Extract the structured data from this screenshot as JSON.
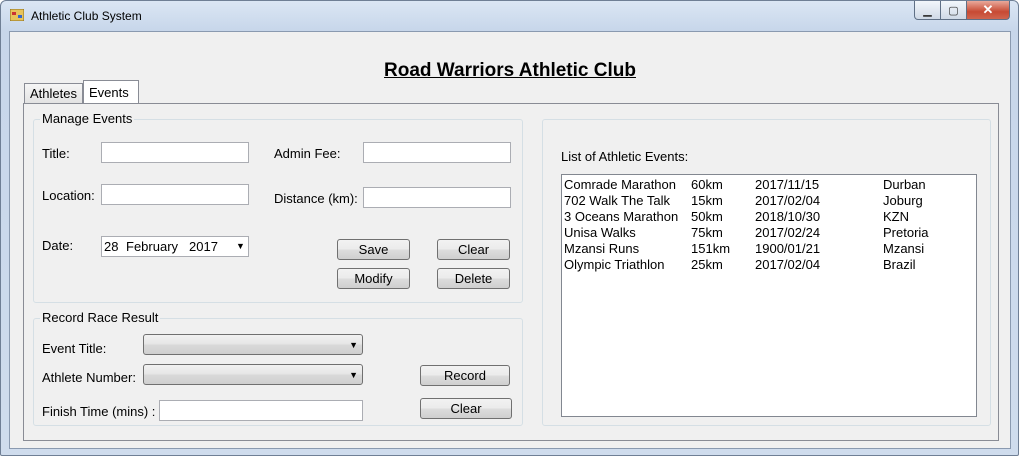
{
  "window": {
    "title": "Athletic Club System"
  },
  "header": {
    "club_title": "Road Warriors Athletic Club"
  },
  "tabs": [
    {
      "label": "Athletes"
    },
    {
      "label": "Events"
    }
  ],
  "manage_events": {
    "legend": "Manage Events",
    "title_label": "Title:",
    "location_label": "Location:",
    "date_label": "Date:",
    "admin_fee_label": "Admin Fee:",
    "distance_label": "Distance (km):",
    "title_value": "",
    "location_value": "",
    "admin_fee_value": "",
    "distance_value": "",
    "date": {
      "day": "28",
      "month": "February",
      "year": "2017"
    },
    "save_label": "Save",
    "clear_label": "Clear",
    "modify_label": "Modify",
    "delete_label": "Delete"
  },
  "race_result": {
    "legend": "Record Race Result",
    "event_title_label": "Event Title:",
    "athlete_number_label": "Athlete Number:",
    "finish_time_label": "Finish Time (mins) :",
    "event_title_value": "",
    "athlete_number_value": "",
    "finish_time_value": "",
    "record_label": "Record",
    "clear_label": "Clear"
  },
  "events_list": {
    "label": "List of Athletic Events:",
    "items": [
      {
        "title": "Comrade Marathon",
        "distance": "60km",
        "date": "2017/11/15",
        "location": "Durban"
      },
      {
        "title": "702 Walk The Talk",
        "distance": "15km",
        "date": "2017/02/04",
        "location": "Joburg"
      },
      {
        "title": "3 Oceans Marathon",
        "distance": "50km",
        "date": "2018/10/30",
        "location": "KZN"
      },
      {
        "title": "Unisa Walks",
        "distance": "75km",
        "date": "2017/02/24",
        "location": "Pretoria"
      },
      {
        "title": "Mzansi Runs",
        "distance": "151km",
        "date": "1900/01/21",
        "location": "Mzansi"
      },
      {
        "title": "Olympic Triathlon",
        "distance": "25km",
        "date": "2017/02/04",
        "location": "Brazil"
      }
    ]
  }
}
